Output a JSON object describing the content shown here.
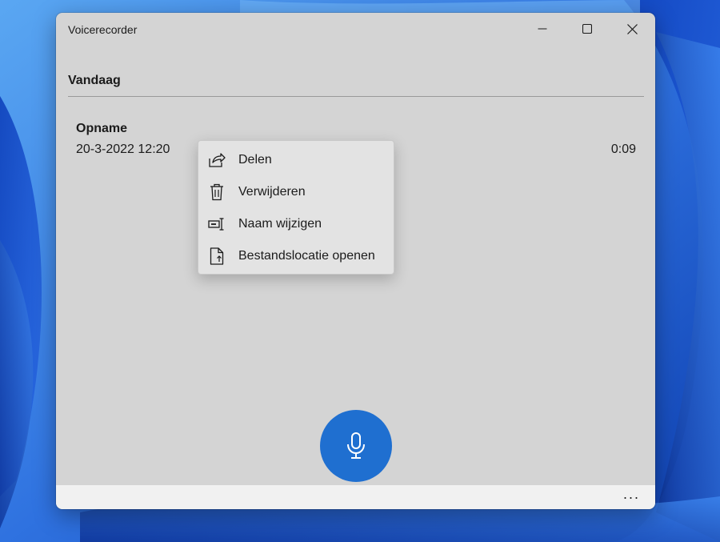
{
  "window": {
    "title": "Voicerecorder",
    "controls": {
      "minimize_icon": "minimize-icon",
      "maximize_icon": "maximize-icon",
      "close_icon": "close-icon"
    }
  },
  "section": {
    "header": "Vandaag"
  },
  "recording": {
    "name": "Opname",
    "date": "20-3-2022 12:20",
    "duration": "0:09"
  },
  "context_menu": {
    "items": [
      {
        "label": "Delen",
        "icon": "share-icon"
      },
      {
        "label": "Verwijderen",
        "icon": "trash-icon"
      },
      {
        "label": "Naam wijzigen",
        "icon": "rename-icon"
      },
      {
        "label": "Bestandslocatie openen",
        "icon": "file-location-icon"
      }
    ]
  },
  "record_button": {
    "icon": "microphone-icon",
    "color": "#1f6fd0"
  },
  "bottom_bar": {
    "more_label": "···"
  },
  "colors": {
    "accent": "#1f6fd0",
    "window_bg": "#d4d4d4",
    "wallpaper": "#1f5fd6"
  }
}
